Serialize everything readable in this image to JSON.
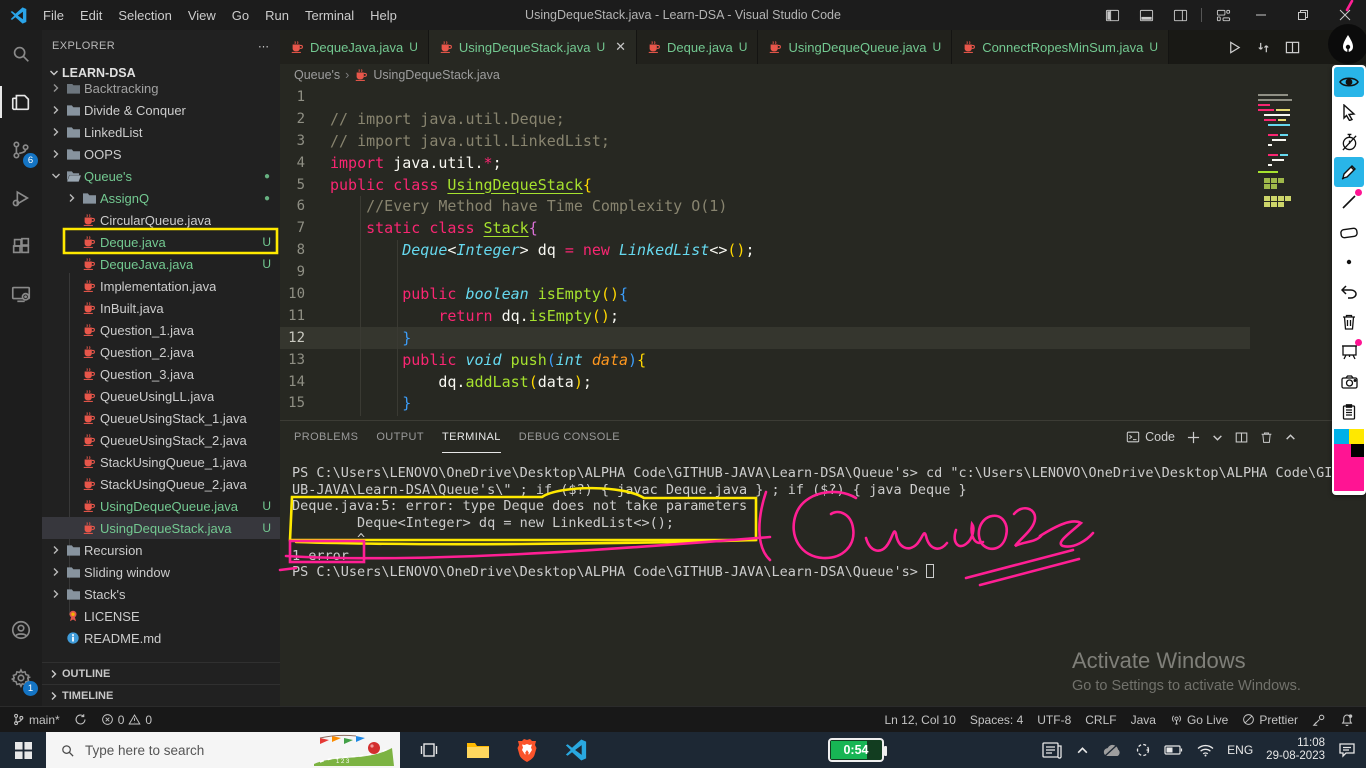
{
  "window": {
    "title": "UsingDequeStack.java - Learn-DSA - Visual Studio Code",
    "menus": [
      "File",
      "Edit",
      "Selection",
      "View",
      "Go",
      "Run",
      "Terminal",
      "Help"
    ]
  },
  "activity_bar": {
    "source_control_badge": "6",
    "settings_badge": "1"
  },
  "explorer": {
    "title": "EXPLORER",
    "ellipsis": "⋯",
    "root": "LEARN-DSA",
    "items": [
      {
        "label": "Backtracking",
        "type": "folder",
        "depth": 0,
        "cut": true
      },
      {
        "label": "Divide & Conquer",
        "type": "folder",
        "depth": 0
      },
      {
        "label": "LinkedList",
        "type": "folder",
        "depth": 0
      },
      {
        "label": "OOPS",
        "type": "folder",
        "depth": 0
      },
      {
        "label": "Queue's",
        "type": "folder",
        "depth": 0,
        "expanded": true,
        "green": true,
        "dot": true
      },
      {
        "label": "AssignQ",
        "type": "folder",
        "depth": 1,
        "green": true,
        "dot": true
      },
      {
        "label": "CircularQueue.java",
        "type": "java",
        "depth": 1
      },
      {
        "label": "Deque.java",
        "type": "java",
        "depth": 1,
        "green": true,
        "badge": "U"
      },
      {
        "label": "DequeJava.java",
        "type": "java",
        "depth": 1,
        "green": true,
        "badge": "U"
      },
      {
        "label": "Implementation.java",
        "type": "java",
        "depth": 1
      },
      {
        "label": "InBuilt.java",
        "type": "java",
        "depth": 1
      },
      {
        "label": "Question_1.java",
        "type": "java",
        "depth": 1
      },
      {
        "label": "Question_2.java",
        "type": "java",
        "depth": 1
      },
      {
        "label": "Question_3.java",
        "type": "java",
        "depth": 1
      },
      {
        "label": "QueueUsingLL.java",
        "type": "java",
        "depth": 1
      },
      {
        "label": "QueueUsingStack_1.java",
        "type": "java",
        "depth": 1
      },
      {
        "label": "QueueUsingStack_2.java",
        "type": "java",
        "depth": 1
      },
      {
        "label": "StackUsingQueue_1.java",
        "type": "java",
        "depth": 1
      },
      {
        "label": "StackUsingQueue_2.java",
        "type": "java",
        "depth": 1
      },
      {
        "label": "UsingDequeQueue.java",
        "type": "java",
        "depth": 1,
        "green": true,
        "badge": "U"
      },
      {
        "label": "UsingDequeStack.java",
        "type": "java",
        "depth": 1,
        "green": true,
        "badge": "U",
        "selected": true
      },
      {
        "label": "Recursion",
        "type": "folder",
        "depth": 0
      },
      {
        "label": "Sliding window",
        "type": "folder",
        "depth": 0
      },
      {
        "label": "Stack's",
        "type": "folder",
        "depth": 0
      },
      {
        "label": "LICENSE",
        "type": "license",
        "depth": 0
      },
      {
        "label": "README.md",
        "type": "readme",
        "depth": 0
      }
    ],
    "outline_label": "OUTLINE",
    "timeline_label": "TIMELINE"
  },
  "editor_tabs": [
    {
      "label": "DequeJava.java",
      "badge": "U",
      "active": false
    },
    {
      "label": "UsingDequeStack.java",
      "badge": "U",
      "active": true
    },
    {
      "label": "Deque.java",
      "badge": "U",
      "active": false
    },
    {
      "label": "UsingDequeQueue.java",
      "badge": "U",
      "active": false
    },
    {
      "label": "ConnectRopesMinSum.java",
      "badge": "U",
      "active": false
    }
  ],
  "breadcrumb": {
    "folder": "Queue's",
    "file": "UsingDequeStack.java"
  },
  "code": {
    "current_line": 12,
    "lines": [
      {
        "n": 1,
        "segs": []
      },
      {
        "n": 2,
        "segs": [
          [
            "// import java.util.Deque;",
            "cmt"
          ]
        ]
      },
      {
        "n": 3,
        "segs": [
          [
            "// import java.util.LinkedList;",
            "cmt"
          ]
        ]
      },
      {
        "n": 4,
        "segs": [
          [
            "import",
            "kw"
          ],
          [
            " java.util.",
            "fg"
          ],
          [
            "*",
            "kw"
          ],
          [
            ";",
            "fg"
          ]
        ]
      },
      {
        "n": 5,
        "segs": [
          [
            "public class ",
            "kw"
          ],
          [
            "UsingDequeStack",
            "cls"
          ],
          [
            "{",
            "b1"
          ]
        ]
      },
      {
        "n": 6,
        "segs": [
          [
            "    //Every Method have Time Complexity O(1)",
            "cmt"
          ]
        ]
      },
      {
        "n": 7,
        "segs": [
          [
            "    static class ",
            "kw"
          ],
          [
            "Stack",
            "cls"
          ],
          [
            "{",
            "b2"
          ]
        ]
      },
      {
        "n": 8,
        "segs": [
          [
            "        ",
            "fg"
          ],
          [
            "Deque",
            "ty"
          ],
          [
            "<",
            "fg"
          ],
          [
            "Integer",
            "ty"
          ],
          [
            "> ",
            "fg"
          ],
          [
            "dq ",
            "fg"
          ],
          [
            "=",
            "kw"
          ],
          [
            " ",
            "fg"
          ],
          [
            "new",
            "kw"
          ],
          [
            " ",
            "fg"
          ],
          [
            "LinkedList",
            "ty"
          ],
          [
            "<>",
            "fg"
          ],
          [
            "()",
            "b1"
          ],
          [
            ";",
            "fg"
          ]
        ]
      },
      {
        "n": 9,
        "segs": []
      },
      {
        "n": 10,
        "segs": [
          [
            "        ",
            "fg"
          ],
          [
            "public ",
            "kw"
          ],
          [
            "boolean ",
            "ty"
          ],
          [
            "isEmpty",
            "fn"
          ],
          [
            "()",
            "b1"
          ],
          [
            "{",
            "b3"
          ]
        ]
      },
      {
        "n": 11,
        "segs": [
          [
            "            ",
            "fg"
          ],
          [
            "return",
            "kw"
          ],
          [
            " dq.",
            "fg"
          ],
          [
            "isEmpty",
            "fn"
          ],
          [
            "()",
            "b1"
          ],
          [
            ";",
            "fg"
          ]
        ]
      },
      {
        "n": 12,
        "segs": [
          [
            "        ",
            "fg"
          ],
          [
            "}",
            "b3"
          ]
        ]
      },
      {
        "n": 13,
        "segs": [
          [
            "        ",
            "fg"
          ],
          [
            "public ",
            "kw"
          ],
          [
            "void ",
            "ty"
          ],
          [
            "push",
            "fn"
          ],
          [
            "(",
            "b3"
          ],
          [
            "int ",
            "ty"
          ],
          [
            "data",
            "pm"
          ],
          [
            ")",
            "b3"
          ],
          [
            "{",
            "b1"
          ]
        ]
      },
      {
        "n": 14,
        "segs": [
          [
            "            ",
            "fg"
          ],
          [
            "dq.",
            "fg"
          ],
          [
            "addLast",
            "fn"
          ],
          [
            "(",
            "b1"
          ],
          [
            "data",
            "fg"
          ],
          [
            ")",
            "b1"
          ],
          [
            ";",
            "fg"
          ]
        ]
      },
      {
        "n": 15,
        "segs": [
          [
            "        ",
            "fg"
          ],
          [
            "}",
            "b3"
          ]
        ]
      }
    ]
  },
  "panel": {
    "tabs": [
      "PROBLEMS",
      "OUTPUT",
      "TERMINAL",
      "DEBUG CONSOLE"
    ],
    "active_tab": "TERMINAL",
    "shell_label": "Code",
    "terminal_lines": [
      "PS C:\\Users\\LENOVO\\OneDrive\\Desktop\\ALPHA Code\\GITHUB-JAVA\\Learn-DSA\\Queue's> cd \"c:\\Users\\LENOVO\\OneDrive\\Desktop\\ALPHA Code\\GIT",
      "UB-JAVA\\Learn-DSA\\Queue's\\\" ; if ($?) { javac Deque.java } ; if ($?) { java Deque }",
      "Deque.java:5: error: type Deque does not take parameters",
      "        Deque<Integer> dq = new LinkedList<>();",
      "        ^",
      "1 error",
      "PS C:\\Users\\LENOVO\\OneDrive\\Desktop\\ALPHA Code\\GITHUB-JAVA\\Learn-DSA\\Queue's> "
    ]
  },
  "status_bar": {
    "branch": "main*",
    "errors": "0",
    "warnings": "0",
    "ln_col": "Ln 12, Col 10",
    "spaces": "Spaces: 4",
    "encoding": "UTF-8",
    "eol": "CRLF",
    "language": "Java",
    "go_live": "Go Live",
    "prettier": "Prettier"
  },
  "taskbar": {
    "search_placeholder": "Type here to search",
    "timer": "0:54",
    "language": "ENG",
    "time": "11:08",
    "date": "29-08-2023"
  },
  "watermark": {
    "line1": "Activate Windows",
    "line2": "Go to Settings to activate Windows."
  },
  "colors": {
    "annotation_pink": "#ff1f94",
    "annotation_yellow": "#ffe900",
    "git_untracked_green": "#73c991",
    "badge_blue": "#1474c4",
    "pen_palette": [
      "#00b0e8",
      "#ffe800",
      "#ff1493",
      "#000000"
    ]
  }
}
